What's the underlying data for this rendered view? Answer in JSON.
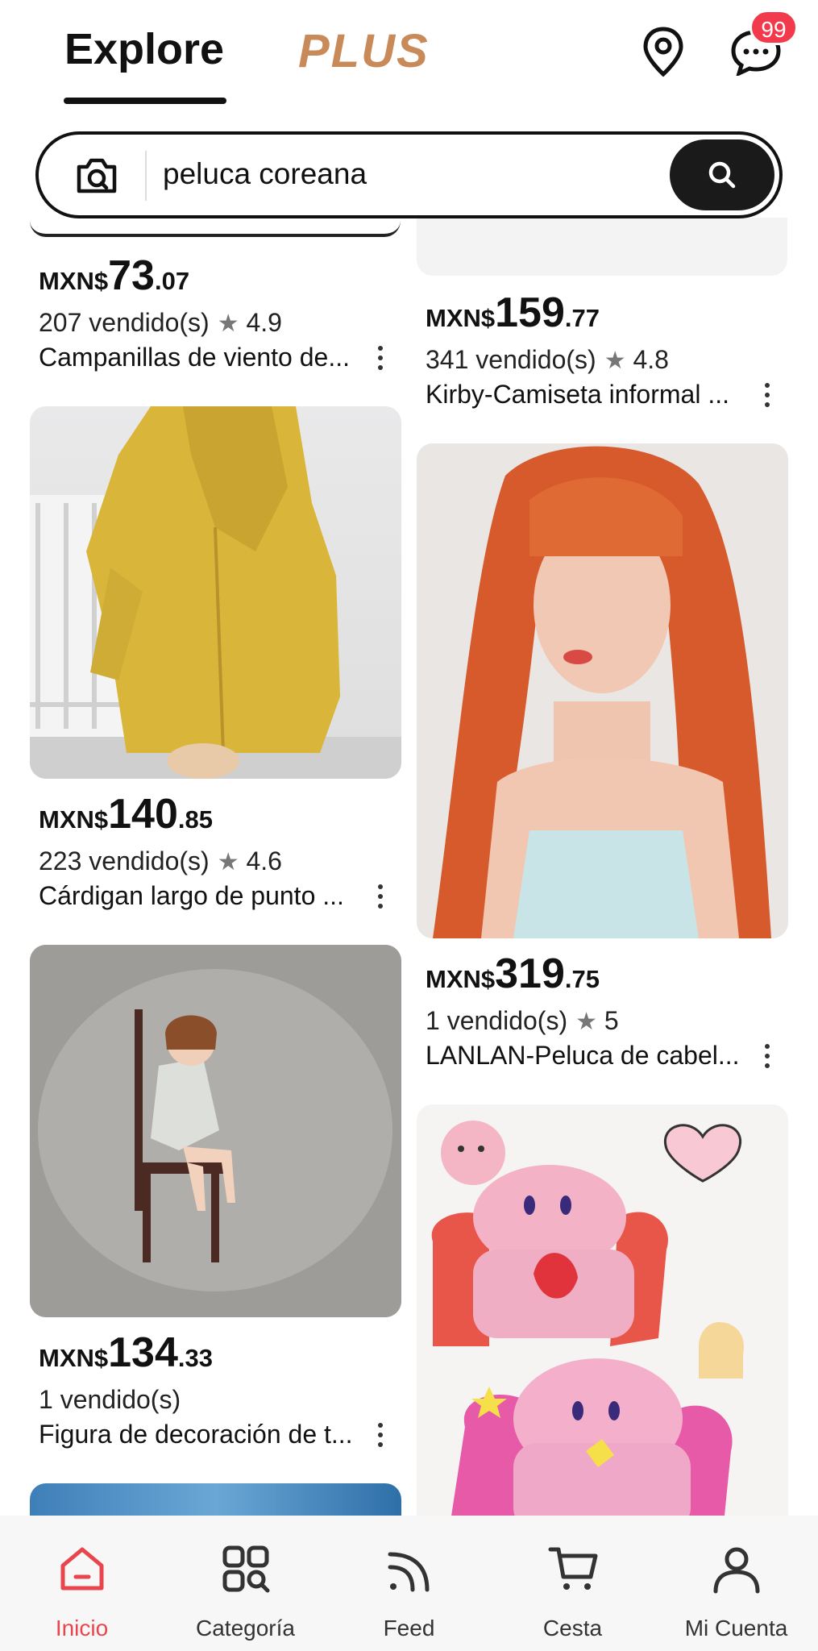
{
  "header": {
    "tab_explore": "Explore",
    "tab_plus": "PLUS",
    "message_badge": "99"
  },
  "search": {
    "query": "peluca coreana"
  },
  "products": [
    {
      "currency": "MXN$",
      "price_int": "73",
      "price_dec": ".07",
      "sold": "207 vendido(s)",
      "rating": "4.9",
      "title": "Campanillas de viento de..."
    },
    {
      "currency": "MXN$",
      "price_int": "159",
      "price_dec": ".77",
      "sold": "341 vendido(s)",
      "rating": "4.8",
      "title": "Kirby-Camiseta informal ..."
    },
    {
      "currency": "MXN$",
      "price_int": "140",
      "price_dec": ".85",
      "sold": "223 vendido(s)",
      "rating": "4.6",
      "title": "Cárdigan largo de punto ..."
    },
    {
      "currency": "MXN$",
      "price_int": "319",
      "price_dec": ".75",
      "sold": "1 vendido(s)",
      "rating": "5",
      "title": "LANLAN-Peluca de cabel..."
    },
    {
      "currency": "MXN$",
      "price_int": "134",
      "price_dec": ".33",
      "sold": "1 vendido(s)",
      "rating": "",
      "title": "Figura de decoración de t..."
    }
  ],
  "bottom_nav": {
    "home": "Inicio",
    "category": "Categoría",
    "feed": "Feed",
    "cart": "Cesta",
    "account": "Mi Cuenta"
  },
  "colors": {
    "accent_red": "#e8464c",
    "badge_red": "#f23a4c",
    "plus_brand": "#c98a5a"
  }
}
